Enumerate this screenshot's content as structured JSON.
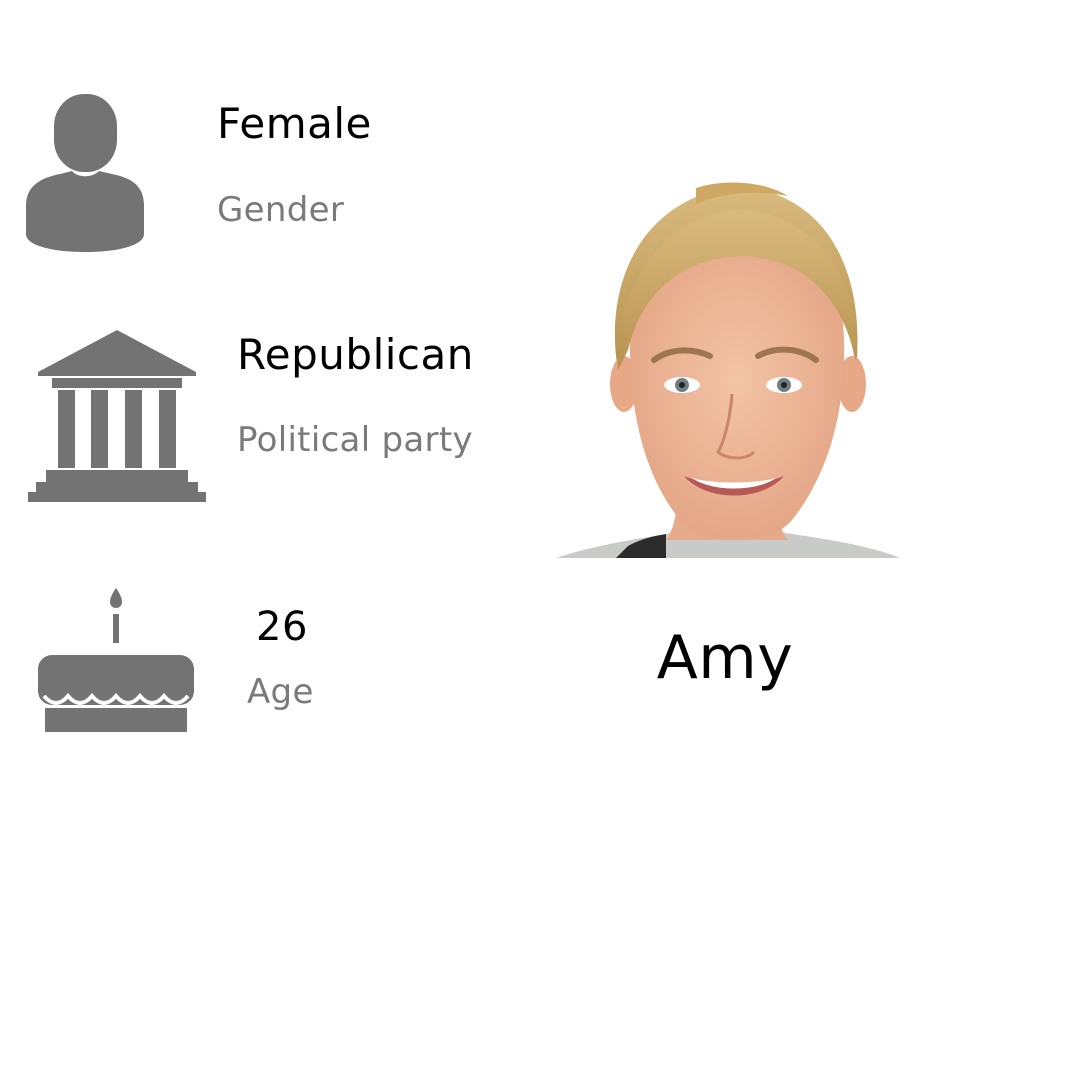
{
  "profile": {
    "name": "Amy",
    "photo_icon": "person-portrait",
    "attributes": {
      "gender": {
        "value": "Female",
        "label": "Gender",
        "icon": "person-silhouette-icon"
      },
      "party": {
        "value": "Republican",
        "label": "Political party",
        "icon": "government-building-icon"
      },
      "age": {
        "value": "26",
        "label": "Age",
        "icon": "birthday-cake-icon"
      }
    }
  },
  "colors": {
    "icon": "#737373",
    "value_text": "#000000",
    "label_text": "#7a7a7a",
    "background": "#ffffff"
  }
}
